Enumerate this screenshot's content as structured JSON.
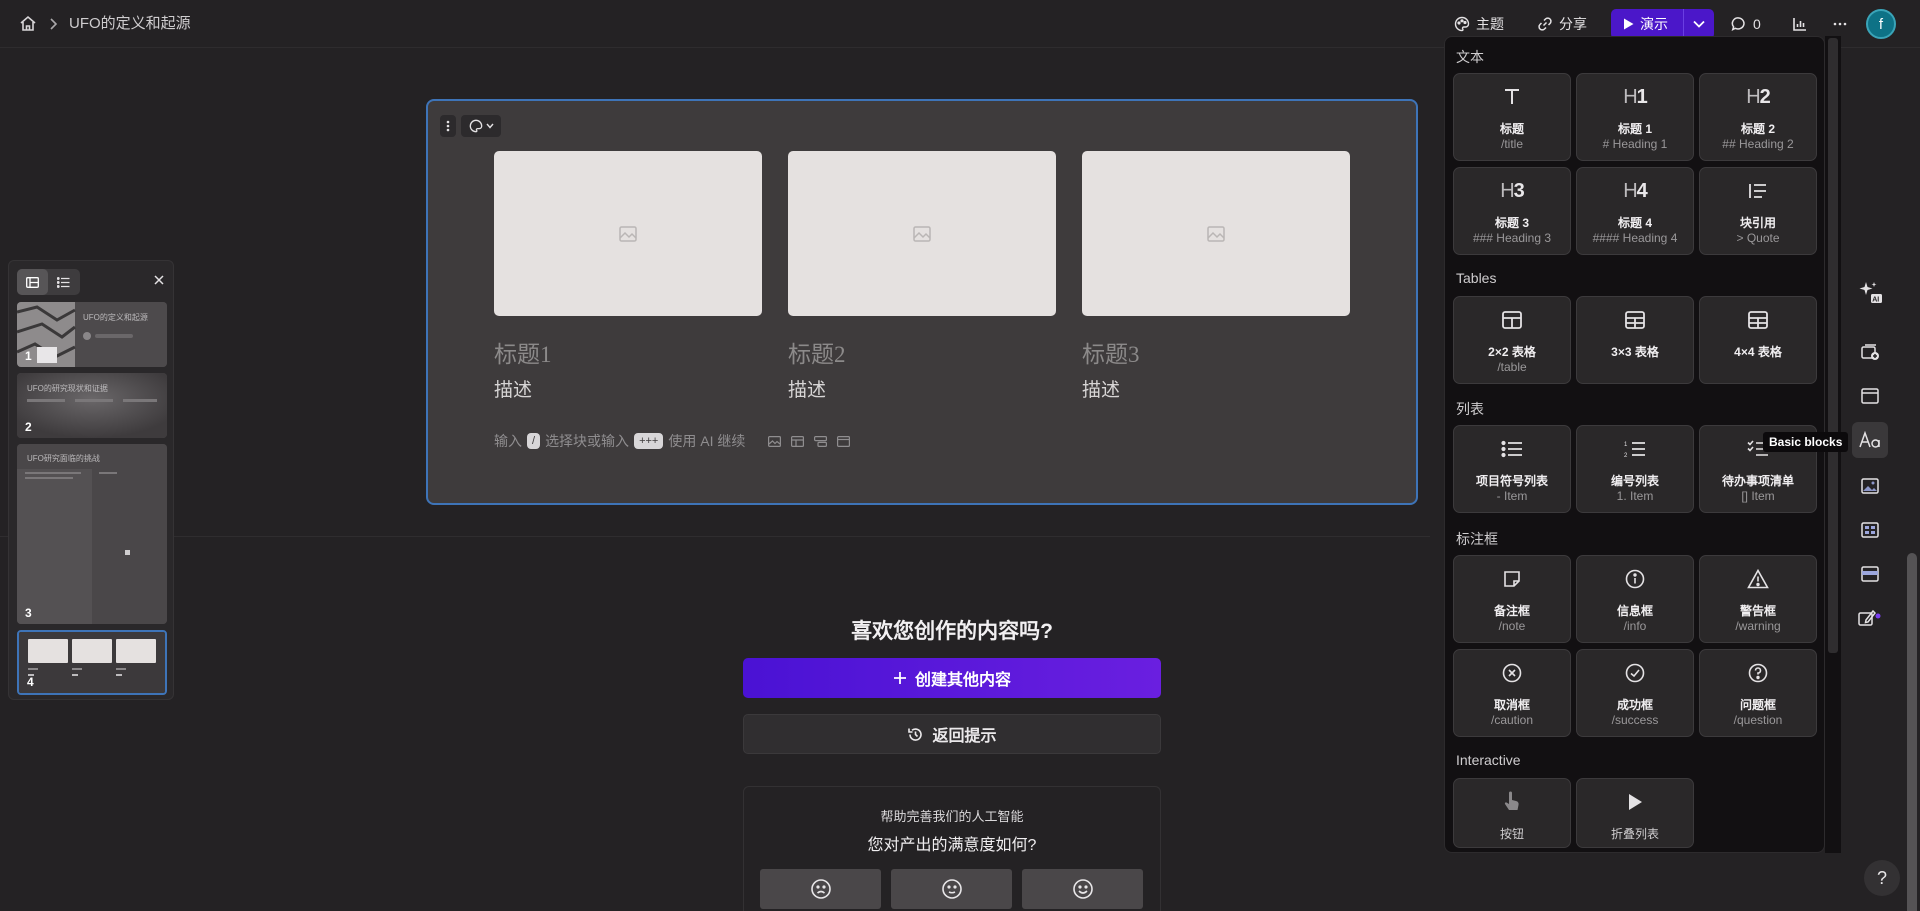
{
  "topbar": {
    "breadcrumb": "UFO的定义和起源",
    "theme_label": "主题",
    "share_label": "分享",
    "present_label": "演示",
    "comment_count": "0",
    "avatar_initial": "f"
  },
  "card": {
    "columns": [
      {
        "title": "标题1",
        "desc": "描述"
      },
      {
        "title": "标题2",
        "desc": "描述"
      },
      {
        "title": "标题3",
        "desc": "描述"
      }
    ],
    "hint": {
      "p1": "输入",
      "k1": "/",
      "p2": "选择块或输入",
      "k2": "+++",
      "p3": "使用 AI 继续"
    }
  },
  "lower": {
    "title": "喜欢您创作的内容吗?",
    "create_label": "创建其他内容",
    "return_label": "返回提示",
    "feedback_line1": "帮助完善我们的人工智能",
    "feedback_line2": "您对产出的满意度如何?"
  },
  "slides": {
    "items": [
      {
        "num": "1",
        "title": "UFO的定义和起源"
      },
      {
        "num": "2",
        "title": "UFO的研究现状和证据"
      },
      {
        "num": "3",
        "title": "UFO研究面临的挑战"
      },
      {
        "num": "4",
        "title": ""
      }
    ]
  },
  "blockmenu": {
    "sections": {
      "text": "文本",
      "tables": "Tables",
      "lists": "列表",
      "callouts": "标注框",
      "interactive": "Interactive"
    },
    "text_items": [
      {
        "label": "标题",
        "sub": "/title"
      },
      {
        "label": "标题 1",
        "sub": "# Heading 1"
      },
      {
        "label": "标题 2",
        "sub": "## Heading 2"
      },
      {
        "label": "标题 3",
        "sub": "### Heading 3"
      },
      {
        "label": "标题 4",
        "sub": "#### Heading 4"
      },
      {
        "label": "块引用",
        "sub": "> Quote"
      }
    ],
    "table_items": [
      {
        "label": "2×2 表格",
        "sub": "/table"
      },
      {
        "label": "3×3 表格",
        "sub": ""
      },
      {
        "label": "4×4 表格",
        "sub": ""
      }
    ],
    "list_items": [
      {
        "label": "项目符号列表",
        "sub": "- Item"
      },
      {
        "label": "编号列表",
        "sub": "1. Item"
      },
      {
        "label": "待办事项清单",
        "sub": "[] Item"
      }
    ],
    "callout_items": [
      {
        "label": "备注框",
        "sub": "/note"
      },
      {
        "label": "信息框",
        "sub": "/info"
      },
      {
        "label": "警告框",
        "sub": "/warning"
      },
      {
        "label": "取消框",
        "sub": "/caution"
      },
      {
        "label": "成功框",
        "sub": "/success"
      },
      {
        "label": "问题框",
        "sub": "/question"
      }
    ],
    "interactive_items": [
      {
        "label": "按钮",
        "sub": ""
      },
      {
        "label": "折叠列表",
        "sub": ""
      }
    ],
    "tooltip": "Basic blocks"
  },
  "heading_glyphs": {
    "h1": "1",
    "h2": "2",
    "h3": "3",
    "h4": "4"
  },
  "colors": {
    "accent": "#4b17c9",
    "selection": "#3e74b8",
    "avatar": "#0e7286"
  }
}
